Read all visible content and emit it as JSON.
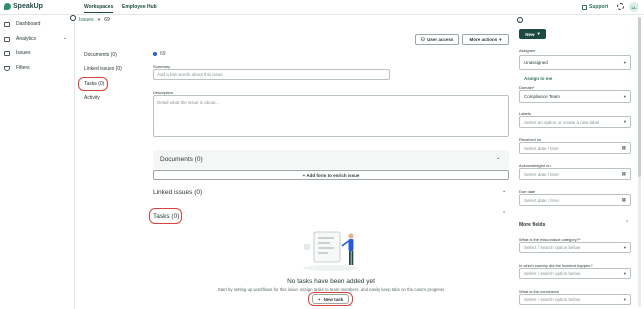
{
  "app": {
    "logo_text": "SpeakUp",
    "user_initials": "LL"
  },
  "topnav": {
    "workspaces": "Workspaces",
    "employee_hub": "Employee Hub",
    "support": "Support"
  },
  "sidebar": {
    "items": [
      {
        "label": "Dashboard",
        "icon": "grid-icon"
      },
      {
        "label": "Analytics",
        "icon": "chart-icon"
      },
      {
        "label": "Issues",
        "icon": "list-icon"
      },
      {
        "label": "Filters",
        "icon": "filter-icon"
      }
    ]
  },
  "breadcrumb": {
    "root": "Issues",
    "sep": "»",
    "current": "69"
  },
  "subnav": {
    "documents": "Documents (0)",
    "linked": "Linked issues (0)",
    "tasks": "Tasks (0)",
    "activity": "Activity"
  },
  "issue": {
    "number": "69"
  },
  "actions": {
    "user_access": "User access",
    "more_actions": "More actions"
  },
  "summary": {
    "label": "Summary",
    "placeholder": "Add a few words about this issue"
  },
  "description": {
    "label": "Description",
    "placeholder": "Detail what the issue is about..."
  },
  "documents": {
    "title": "Documents (0)",
    "add_form": "+  Add form to enrich issue"
  },
  "linked": {
    "title": "Linked issues (0)"
  },
  "tasks": {
    "title": "Tasks (0)",
    "empty_title": "No tasks have been added yet",
    "empty_text": "Start by setting up workflows for this issue, assign tasks to team members, and easily keep tabs on the case's progress",
    "new_task": "New task"
  },
  "right": {
    "new_button": "New",
    "assignee": {
      "label": "Assignee",
      "value": "Unassigned"
    },
    "assign_to_me": "Assign to me",
    "domain": {
      "label": "Domain*",
      "value": "Compliance Team"
    },
    "labels": {
      "label": "Labels",
      "placeholder": "Select an option or create a new label"
    },
    "received": {
      "label": "Received on",
      "placeholder": "Select date / time"
    },
    "acknowledged": {
      "label": "Acknowledged on",
      "placeholder": "Select date / time"
    },
    "due": {
      "label": "Due date",
      "placeholder": "Select date / time"
    },
    "more_fields": "More fields",
    "q1": {
      "label": "What is the misconduct category?*",
      "placeholder": "Select / search option below"
    },
    "q2": {
      "label": "In which country did the incident happen?",
      "placeholder": "Select / search option below"
    },
    "q3": {
      "label": "What is the conclusion",
      "placeholder": "Select / search option below"
    }
  },
  "colors": {
    "brand": "#1d4a42",
    "accent": "#2f6f5c",
    "highlight_ring": "#d9443a",
    "status_dot": "#2a5bd7"
  }
}
